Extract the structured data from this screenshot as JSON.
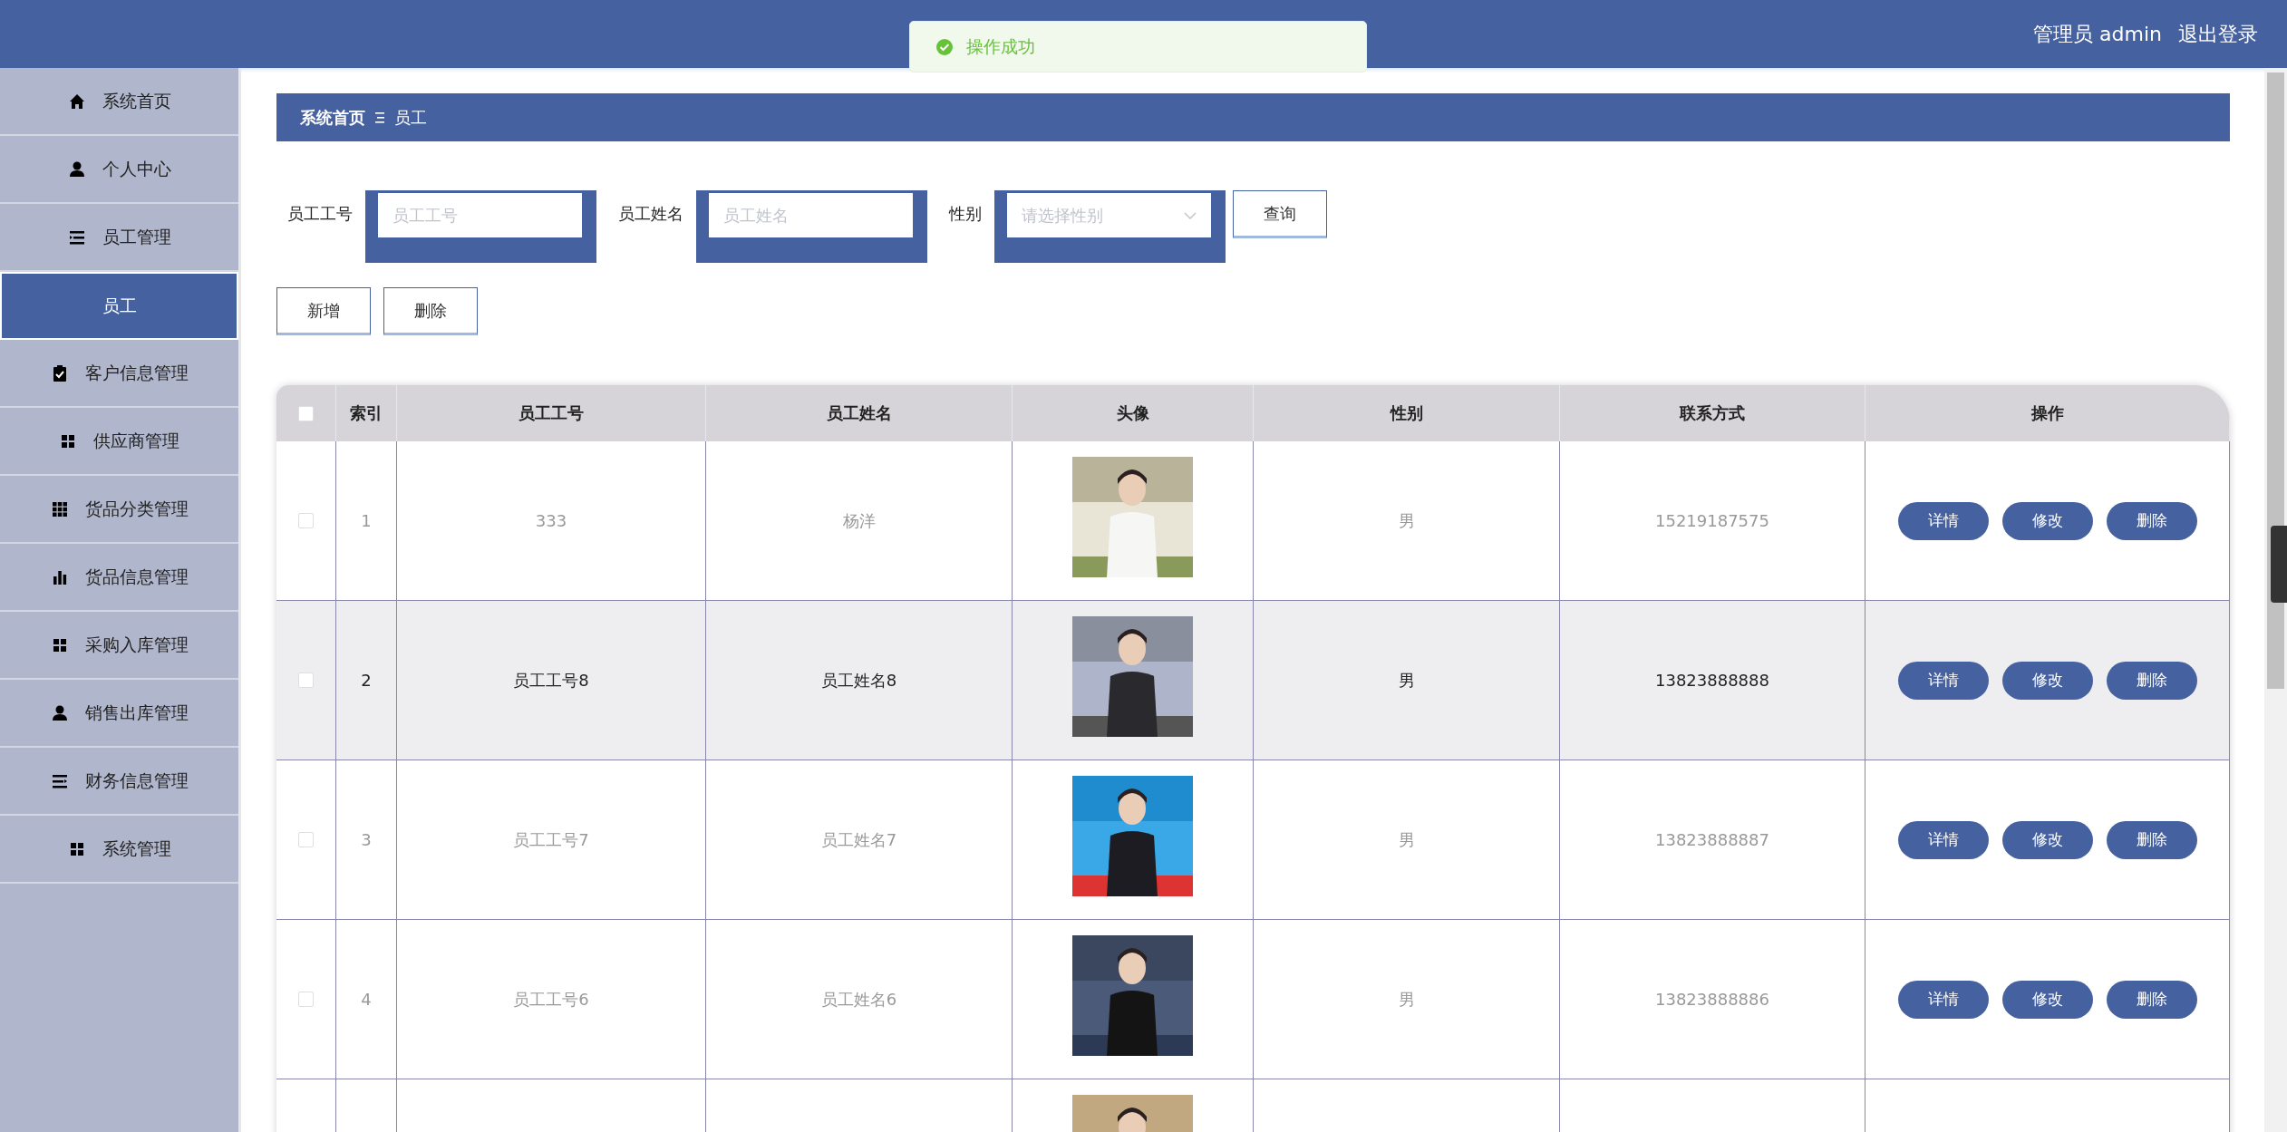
{
  "header": {
    "user": "管理员 admin",
    "logout": "退出登录"
  },
  "toast": {
    "message": "操作成功"
  },
  "sidebar": {
    "items": [
      {
        "label": "系统首页",
        "selected": false
      },
      {
        "label": "个人中心",
        "selected": false
      },
      {
        "label": "员工管理",
        "selected": false,
        "expanded": true,
        "children": [
          {
            "label": "员工",
            "selected": true
          }
        ]
      },
      {
        "label": "客户信息管理",
        "selected": false
      },
      {
        "label": "供应商管理",
        "selected": false
      },
      {
        "label": "货品分类管理",
        "selected": false
      },
      {
        "label": "货品信息管理",
        "selected": false
      },
      {
        "label": "采购入库管理",
        "selected": false
      },
      {
        "label": "销售出库管理",
        "selected": false
      },
      {
        "label": "财务信息管理",
        "selected": false
      },
      {
        "label": "系统管理",
        "selected": false
      }
    ]
  },
  "breadcrumb": {
    "home": "系统首页",
    "current": "员工"
  },
  "search": {
    "fields": [
      {
        "label": "员工工号",
        "placeholder": "员工工号",
        "kind": "text"
      },
      {
        "label": "员工姓名",
        "placeholder": "员工姓名",
        "kind": "text"
      },
      {
        "label": "性别",
        "placeholder": "请选择性别",
        "kind": "select"
      }
    ],
    "submit": "查询"
  },
  "actions": [
    "新增",
    "删除"
  ],
  "table": {
    "select_all_checked": false,
    "columns": [
      "索引",
      "员工工号",
      "员工姓名",
      "头像",
      "性别",
      "联系方式",
      "操作"
    ],
    "rows": [
      {
        "checked": false,
        "highlighted": false,
        "index": "1",
        "id": "333",
        "name": "杨洋",
        "gender": "男",
        "phone": "15219187575",
        "buttons": [
          "详情",
          "修改",
          "删除"
        ]
      },
      {
        "checked": false,
        "highlighted": true,
        "index": "2",
        "id": "员工工号8",
        "name": "员工姓名8",
        "gender": "男",
        "phone": "13823888888",
        "buttons": [
          "详情",
          "修改",
          "删除"
        ]
      },
      {
        "checked": false,
        "highlighted": false,
        "index": "3",
        "id": "员工工号7",
        "name": "员工姓名7",
        "gender": "男",
        "phone": "13823888887",
        "buttons": [
          "详情",
          "修改",
          "删除"
        ]
      },
      {
        "checked": false,
        "highlighted": false,
        "index": "4",
        "id": "员工工号6",
        "name": "员工姓名6",
        "gender": "男",
        "phone": "13823888886",
        "buttons": [
          "详情",
          "修改",
          "删除"
        ]
      },
      {
        "highlighted": false
      }
    ]
  }
}
